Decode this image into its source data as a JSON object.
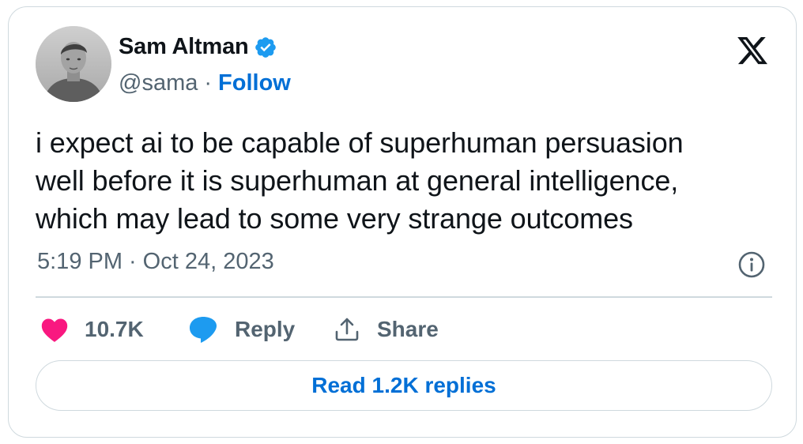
{
  "author": {
    "name": "Sam Altman",
    "handle": "@sama",
    "separator": "·",
    "follow_label": "Follow",
    "verified": true,
    "verified_color": "#1d9bf0"
  },
  "tweet": {
    "line1": "i expect ai to be capable of superhuman persuasion",
    "line2": "well before it is superhuman at general intelligence,",
    "line3": "which may lead to some very strange outcomes",
    "time": "5:19 PM",
    "separator": "·",
    "date": "Oct 24, 2023"
  },
  "actions": {
    "like_count": "10.7K",
    "reply_label": "Reply",
    "share_label": "Share",
    "like_color": "#f91880",
    "reply_color": "#1d9bf0"
  },
  "read_replies_label": "Read 1.2K replies",
  "icons": [
    "x-logo-icon",
    "verified-badge-icon",
    "info-icon",
    "heart-icon",
    "reply-bubble-icon",
    "share-icon"
  ]
}
